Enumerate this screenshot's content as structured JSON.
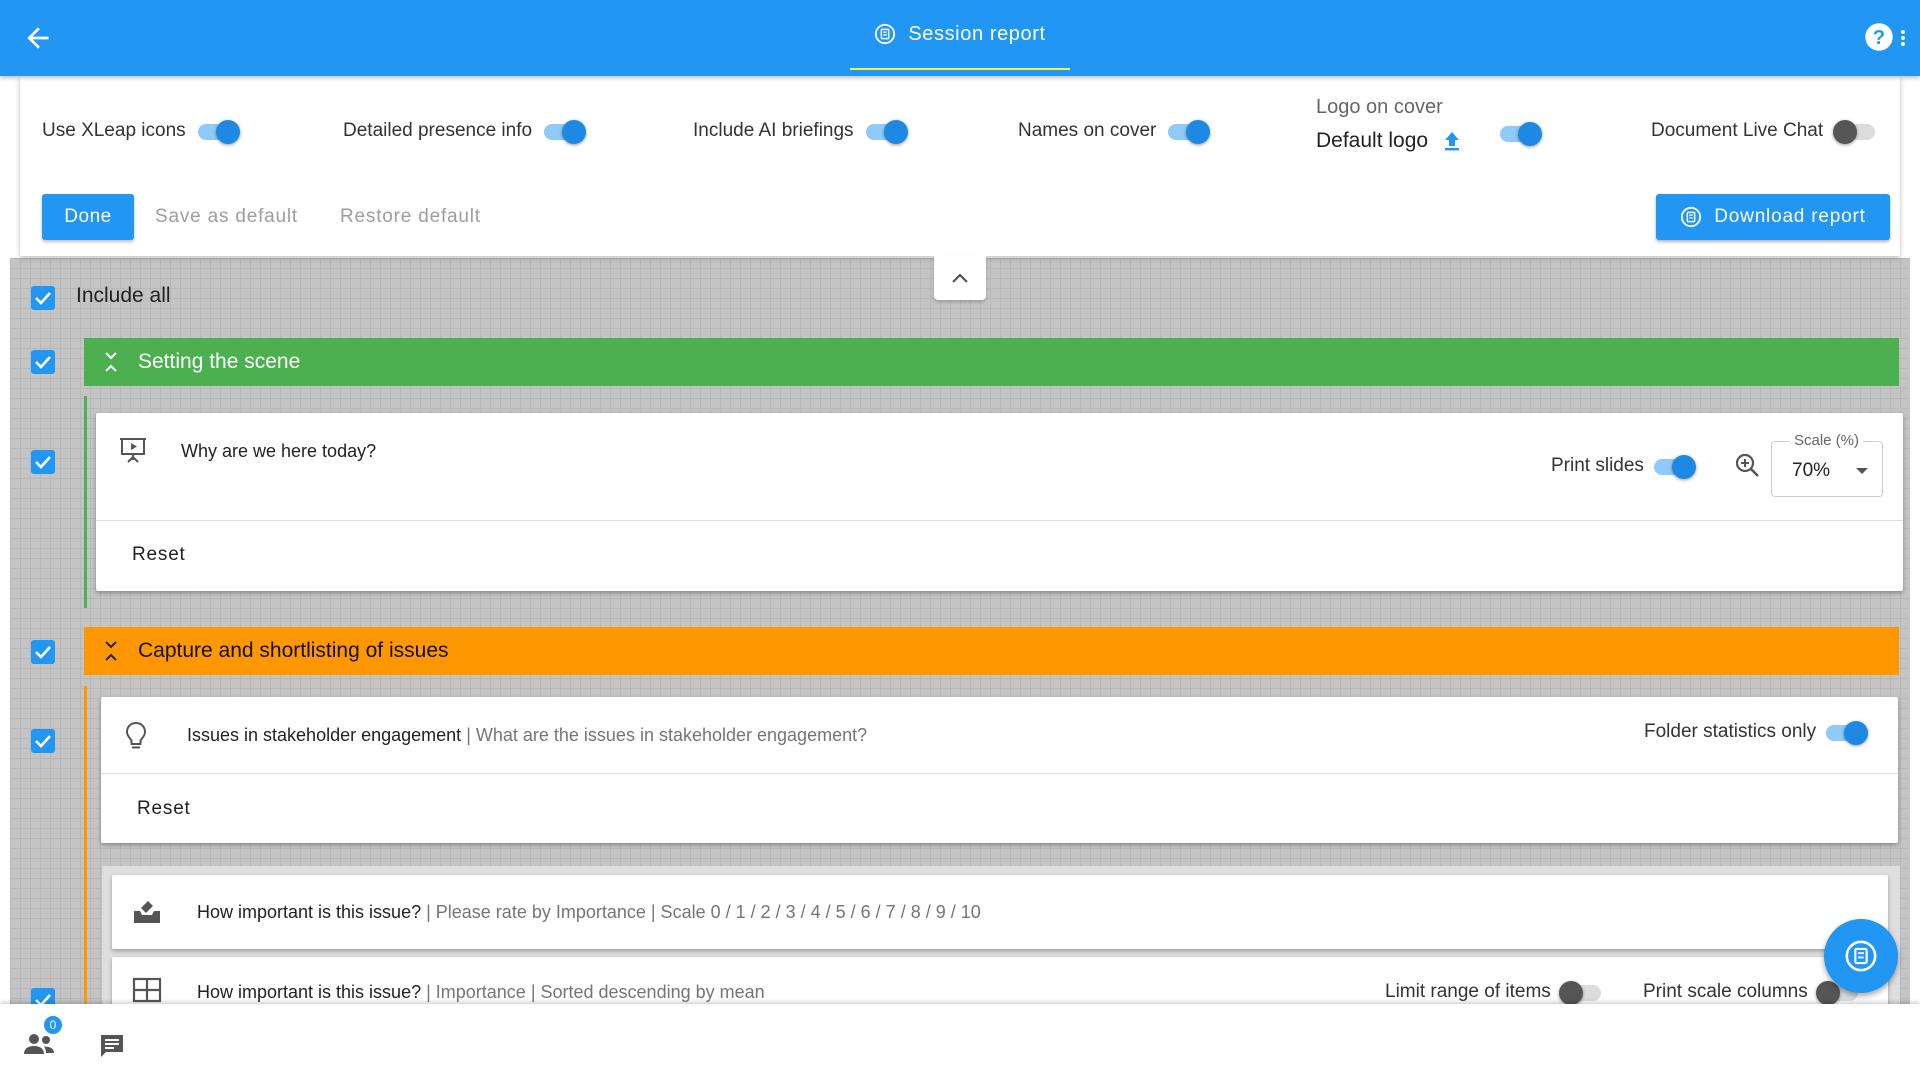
{
  "header": {
    "title": "Session report",
    "help_label": "?"
  },
  "options": {
    "use_xleap_icons": {
      "label": "Use XLeap icons",
      "on": true
    },
    "detailed_presence": {
      "label": "Detailed presence info",
      "on": true
    },
    "ai_briefings": {
      "label": "Include AI briefings",
      "on": true
    },
    "names_on_cover": {
      "label": "Names on cover",
      "on": true
    },
    "logo_on_cover": {
      "label": "Logo on cover",
      "value": "Default logo",
      "on": true
    },
    "document_live_chat": {
      "label": "Document Live Chat",
      "on": false
    }
  },
  "actions": {
    "done": "Done",
    "save_default": "Save as default",
    "restore_default": "Restore default",
    "download": "Download report"
  },
  "include_all": "Include all",
  "sections": [
    {
      "title": "Setting the scene",
      "color": "#4caf50",
      "items": [
        {
          "question": "Why are we here today?",
          "print_slides_label": "Print slides",
          "print_slides_on": true,
          "scale_label": "Scale (%)",
          "scale_value": "70%",
          "reset": "Reset"
        }
      ]
    },
    {
      "title": "Capture and shortlisting of issues",
      "color": "#ff9800",
      "items": [
        {
          "question": "Issues in stakeholder engagement",
          "detail": " | What are the issues in stakeholder engagement?",
          "folder_stats_label": "Folder statistics only",
          "folder_stats_on": true,
          "reset": "Reset"
        }
      ],
      "nested": [
        {
          "question": "How important is this issue?",
          "detail": " | Please rate by Importance | Scale 0 / 1 / 2 / 3 / 4 / 5 / 6 / 7 / 8 / 9 / 10"
        },
        {
          "question": "How important is this issue?",
          "detail": "  |  Importance  | Sorted descending by mean",
          "limit_range_label": "Limit range of items",
          "limit_range_on": false,
          "print_scale_label": "Print scale columns",
          "print_scale_on": false
        }
      ]
    }
  ],
  "bottom": {
    "participants_count": "0"
  },
  "colors": {
    "primary": "#2196f3",
    "green": "#4caf50",
    "orange": "#ff9800",
    "accent_underline": "#ffeb3b"
  }
}
